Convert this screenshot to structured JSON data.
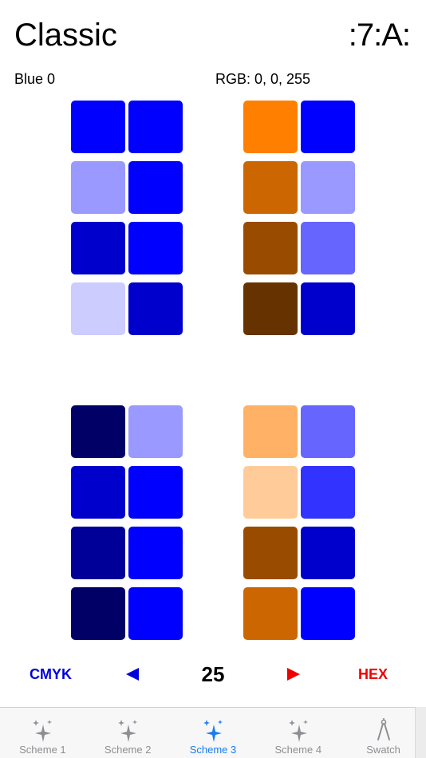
{
  "header": {
    "title": "Classic",
    "logo": ":7:A:"
  },
  "selection": {
    "name": "Blue 0",
    "rgb": "RGB: 0, 0, 255"
  },
  "grids": [
    {
      "swatches": [
        "#0000ff",
        "#0000ff",
        "#9999ff",
        "#0000ff",
        "#0000cc",
        "#0000ff",
        "#ccccff",
        "#0000cc"
      ]
    },
    {
      "swatches": [
        "#ff8000",
        "#0000ff",
        "#cc6600",
        "#9999ff",
        "#994c00",
        "#6666ff",
        "#663300",
        "#0000cc"
      ]
    },
    {
      "swatches": [
        "#000066",
        "#9999ff",
        "#0000cc",
        "#0000ff",
        "#000099",
        "#0000ff",
        "#000066",
        "#0000ff"
      ]
    },
    {
      "swatches": [
        "#ffb266",
        "#6666ff",
        "#ffcc99",
        "#3333ff",
        "#994c00",
        "#0000cc",
        "#cc6600",
        "#0000ff"
      ]
    }
  ],
  "controls": {
    "cmyk_label": "CMYK",
    "hex_label": "HEX",
    "step": "25",
    "cmyk_color": "#0000dd",
    "hex_color": "#ee0000"
  },
  "tabs": [
    {
      "label": "Scheme 1",
      "icon": "sparkle-icon"
    },
    {
      "label": "Scheme 2",
      "icon": "sparkle-icon"
    },
    {
      "label": "Scheme 3",
      "icon": "sparkle-icon",
      "active": true
    },
    {
      "label": "Scheme 4",
      "icon": "sparkle-icon"
    },
    {
      "label": "Swatch",
      "icon": "compass-icon"
    }
  ],
  "colors": {
    "tab_active": "#1a7cf0",
    "tab_inactive": "#8e8e93"
  }
}
